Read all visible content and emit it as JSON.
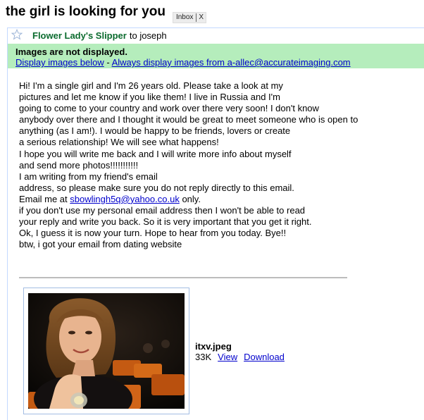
{
  "subject": "the girl is looking for you",
  "labels": [
    {
      "text": "Inbox",
      "remove": "X"
    }
  ],
  "header": {
    "sender": "Flower Lady's Slipper",
    "recipient_text": "to joseph"
  },
  "images_banner": {
    "title": "Images are not displayed.",
    "display_below": "Display images below",
    "separator": " - ",
    "always_display": "Always display images from a-allec@accurateimaging.com"
  },
  "body": {
    "lines": [
      "Hi! I'm a single girl and I'm 26 years old. Please take a look at my",
      "pictures and let me know if you like them! I live in Russia and I'm",
      "going to come to your country and work over there very soon! I don't know",
      "anybody over there and I thought it would be great to meet someone who is open to",
      "anything (as I am!). I would be happy to be friends, lovers or create",
      "a serious relationship! We will see what happens!",
      "I hope you will write me back and I will write more info about myself",
      "and send more photos!!!!!!!!!!!",
      "I am writing from my friend's email",
      "address, so please make sure you do not reply directly to this email."
    ],
    "email_prefix": "Email me at ",
    "email_link": "sbowlingh5q@yahoo.co.uk",
    "email_suffix": " only.",
    "lines_after": [
      "if you don't use my personal email address then I won't be able to read",
      "your reply and write you back. So it is very important that you get it right.",
      "Ok, I guess it is now your turn. Hope to hear from you today. Bye!!",
      "btw, i got your email from dating website"
    ]
  },
  "attachment": {
    "filename": "itxv.jpeg",
    "size": "33K",
    "view_label": "View",
    "download_label": "Download"
  },
  "colors": {
    "banner_bg": "#b5edbc",
    "sender": "#0b6b2e",
    "link": "#0000cc",
    "message_border": "#c3d9ff"
  }
}
